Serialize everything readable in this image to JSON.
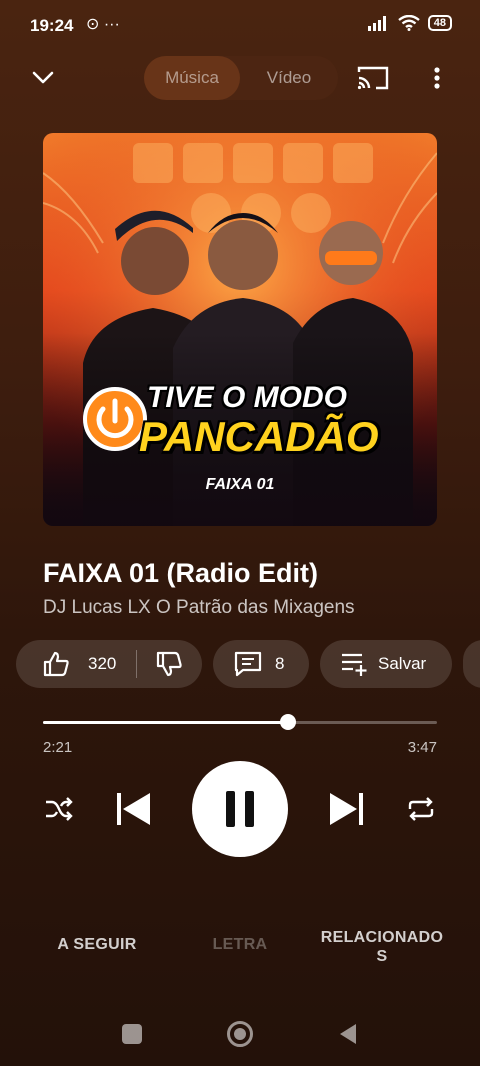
{
  "status_bar": {
    "time": "19:24",
    "notification_icons": "⊙ ···",
    "battery": "48"
  },
  "header": {
    "tabs": [
      {
        "label": "Música",
        "active": true
      },
      {
        "label": "Vídeo",
        "active": false
      }
    ]
  },
  "artwork": {
    "line1": "TIVE O MODO",
    "line2": "PANCADÃO",
    "track_label": "FAIXA 01"
  },
  "song": {
    "title": "FAIXA 01 (Radio Edit)",
    "artist": "DJ Lucas LX O Patrão das Mixagens"
  },
  "actions": {
    "likes": "320",
    "comments": "8",
    "save_label": "Salvar"
  },
  "player": {
    "elapsed": "2:21",
    "duration": "3:47",
    "progress_fraction": 0.621
  },
  "bottom_tabs": {
    "up_next": "A SEGUIR",
    "lyrics": "LETRA",
    "related_line1": "RELACIONADO",
    "related_line2": "S"
  },
  "colors": {
    "background_top": "#4a2410",
    "background_bottom": "#231109",
    "artwork_orange": "#f07a2a",
    "logo_yellow": "#ffd21e"
  }
}
